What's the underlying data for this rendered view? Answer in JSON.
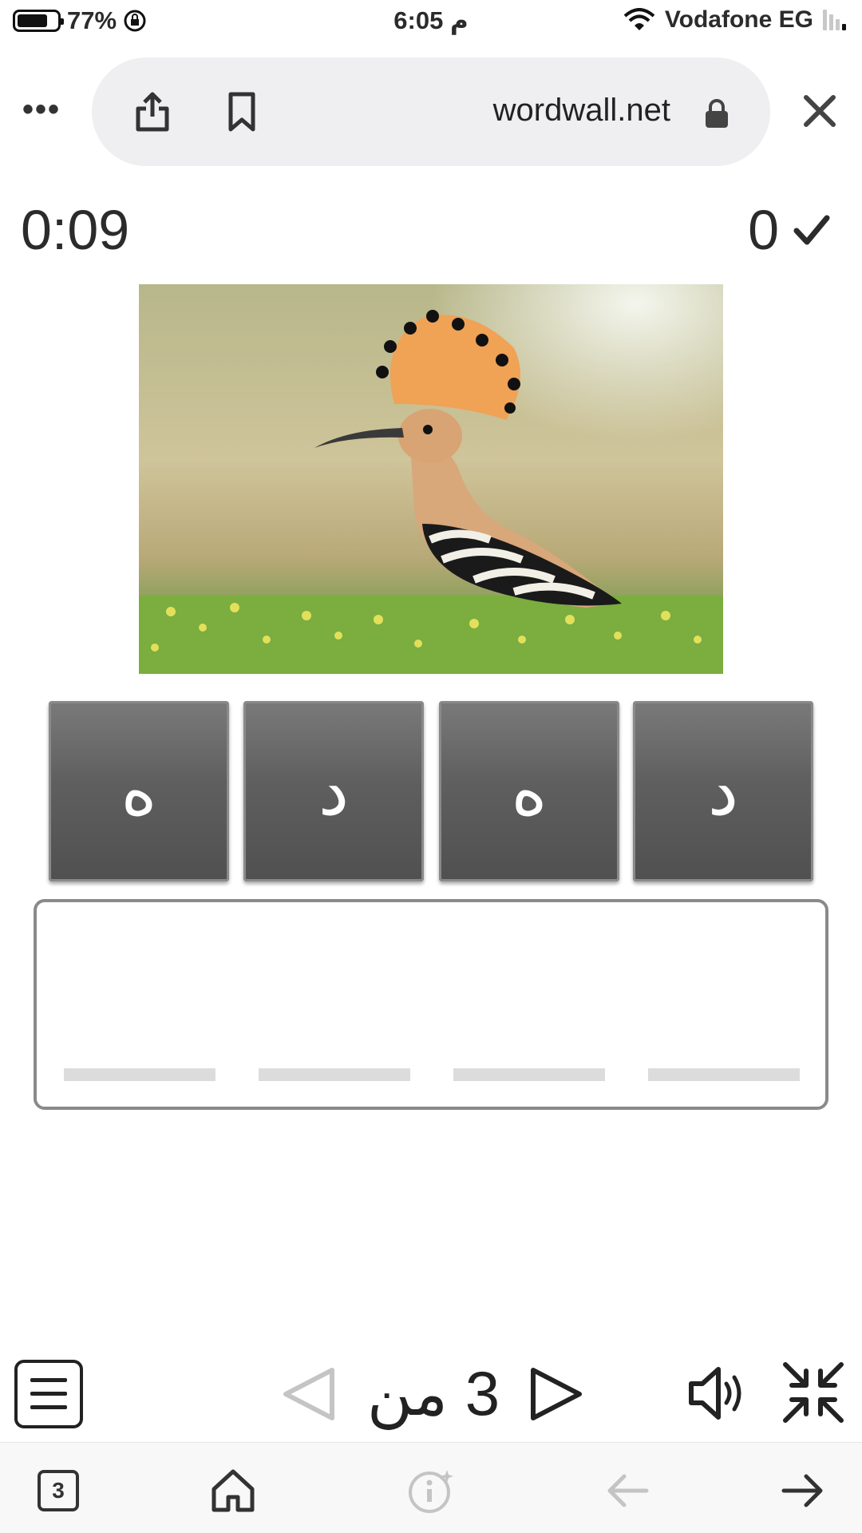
{
  "status_bar": {
    "battery": "77%",
    "battery_level": 0.77,
    "time": "6:05 م",
    "carrier": "Vodafone EG"
  },
  "browser": {
    "url": "wordwall.net",
    "icons": [
      "more-icon",
      "share-icon",
      "bookmark-icon",
      "lock-icon",
      "close-icon"
    ]
  },
  "game": {
    "timer": "0:09",
    "score": "0",
    "image_icon": "hoopoe-bird-photo",
    "tiles": [
      "ه",
      "د",
      "ه",
      "د"
    ],
    "answer_slots": 4,
    "pager": "3 من 3"
  },
  "bottom_nav": {
    "tabs_count": "3",
    "icons": [
      "tabs-icon",
      "home-icon",
      "info-icon",
      "back-arrow-icon",
      "forward-arrow-icon"
    ]
  },
  "colors": {
    "tile": "#5f5f5f",
    "pill": "#efeff1",
    "disabled": "#c4c4c4"
  }
}
